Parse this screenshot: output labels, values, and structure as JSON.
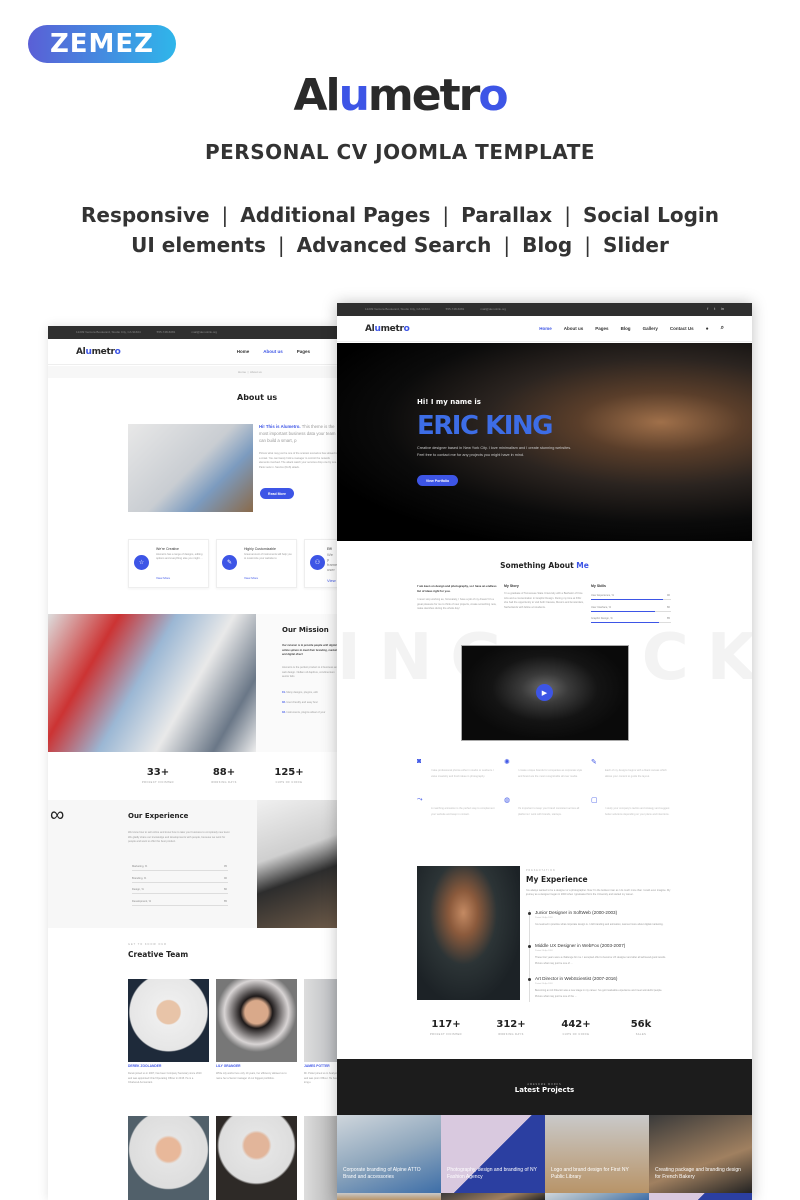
{
  "header": {
    "vendor_logo": "ZEMEZ",
    "brand_a": "Al",
    "brand_b": "u",
    "brand_c": "metr",
    "brand_d": "o",
    "subtitle": "PERSONAL CV  JOOMLA TEMPLATE",
    "features_row1": [
      "Responsive",
      "Additional Pages",
      "Parallax",
      "Social Login"
    ],
    "features_row2": [
      "UI elements",
      "Advanced Search",
      "Blog",
      "Slider"
    ],
    "separator": "|"
  },
  "colors": {
    "accent": "#3d55e6",
    "dark": "#2f2f2f"
  },
  "left_mock": {
    "topbar": [
      "12209 Ventura Boulevard, Studio City, CA 91604",
      "555-748-6081",
      "mail@demolink.org"
    ],
    "logo": "Alumetro",
    "nav": [
      "Home",
      "About us",
      "Pages"
    ],
    "active_nav": "About us",
    "breadcrumb": [
      "Home",
      "About us"
    ],
    "about_title": "About us",
    "intro_highlight": "Hi! This is Alumetro.",
    "intro_rest": "This theme is the most important business data your team can build a smart, p",
    "intro_body": "Picture what may just be one of the scariest scenarios has slowed to a crawl. You can barely hold a manager to control the network elements involved. The attack watch your services drop one by one. Panic sets in. Service (DoS) attack.",
    "read_more": "Read More",
    "cards": [
      {
        "title": "We're Creative",
        "text": "Alumetro has a range of designs, editing options and everything else you might ...",
        "link": "View More",
        "icon": "star-icon"
      },
      {
        "title": "Highly Customizable",
        "text": "Great amount of instruments will help you to customize your website to",
        "link": "View More",
        "icon": "brush-icon"
      },
      {
        "title": "Effi",
        "text": "We p frame user",
        "link": "View",
        "icon": "users-icon"
      }
    ],
    "mission_title": "Our Mission",
    "mission_lead": "Our mission is to provide people with digital and online sphere to meet their branding, marketing and digital direct",
    "mission_body": "Alumetro is the perfect product to d business and web design. Nullam ull dapibus, condimentum auctor felis",
    "mission_list": [
      {
        "num": "01.",
        "text": "Many designs, plugins, edit"
      },
      {
        "num": "02.",
        "text": "User-friendly and easy func"
      },
      {
        "num": "03.",
        "text": "Instruments, plugins allowi of your"
      }
    ],
    "stats": [
      {
        "value": "33+",
        "label": "PROJECT FINISHED"
      },
      {
        "value": "88+",
        "label": "WORKING DAYS"
      },
      {
        "value": "125+",
        "label": "CUPS OF COFFE"
      }
    ],
    "experience_title": "Our Experience",
    "experience_body": "We know how to sell online and know how to take your business to completely new level. We gladly share our knowledge and developments with people, because we work for people and want to offer the best product.",
    "skills": [
      {
        "label": "Marketing, %",
        "value": 95
      },
      {
        "label": "Branding, %",
        "value": 90
      },
      {
        "label": "Design, %",
        "value": 80
      },
      {
        "label": "Development, %",
        "value": 85
      }
    ],
    "team_kicker": "GET TO KNOW OUR",
    "team_title": "Creative Team",
    "team": [
      {
        "name": "DEREK ZOOLANDER",
        "bio": "Derek joined us in 2007, has been Company Secretary since 2010 and was appointed Chief Operating Officer in 2015. He is a Chartered Accountant."
      },
      {
        "name": "LILY GRANGER",
        "bio": "While Lily works here only 10 years, her efficiency allowed us to name her a Senior manager of our biggest portfolios."
      },
      {
        "name": "JAMES POTTER",
        "bio": "Mr. Potter joined us in Analyst and was prom Officer. He has long e"
      }
    ]
  },
  "right_mock": {
    "topbar": [
      "12209 Ventura Boulevard, Studio City, CA 91604",
      "555-748-6081",
      "mail@demolink.org"
    ],
    "social": [
      "f",
      "t",
      "in"
    ],
    "logo": "Alumetro",
    "nav": [
      "Home",
      "About us",
      "Pages",
      "Blog",
      "Gallery",
      "Contact Us"
    ],
    "active_nav": "Home",
    "hero_greeting": "Hi! I my name is",
    "hero_name": "ERIC KING",
    "hero_desc": "Creative designer based in New York City. I love minimalism and I create stunning websites. Feel free to contact me for any projects you might have in mind.",
    "hero_button": "View Portfolio",
    "about_title_a": "Something About ",
    "about_title_b": "Me",
    "col1_lead": "I' am keen on design and photography, so I have an endless list of ideas right for you.",
    "col1_body": "I never stop working as, fortunately, I have a job of my dream! It's a great pleasure for me to think of new projects, create something new, make sketches during the whole day!",
    "story_title": "My Story",
    "story_body": "I'm a graduate of Tennessee State University with a Bachelor of Fine Arts and a concentration in Graphic Design. During my time at KSU she had the opportunity to visit both Oaxaca, Mexico and Amsterdam, Netherlands with fellow art students.",
    "skills_title": "My Skills",
    "skills": [
      {
        "label": "User Experience, %",
        "value": 90
      },
      {
        "label": "User Interface, %",
        "value": 80
      },
      {
        "label": "Graphic Design, %",
        "value": 85
      }
    ],
    "watermark": "ING   CK",
    "services": [
      {
        "icon": "camera-icon",
        "text": "I take professional photos either in studio or outdoors. I value creativity and fresh ideas in photography."
      },
      {
        "icon": "bulb-icon",
        "text": "I create unique brands for companies as corporate style and brand are the most recognizable all over media."
      },
      {
        "icon": "pencil-icon",
        "text": "Each of my designs begins with a blank canvas which allows your content to guide the layout."
      },
      {
        "icon": "animation-icon",
        "text": "A matching animation is the perfect way to complement your website and keep in contact."
      },
      {
        "icon": "globe-icon",
        "text": "It's important to keep your brand consistent across all platforms I work with brands, startups."
      },
      {
        "icon": "clipboard-icon",
        "text": "I study your company's tactics and strategy and suggest better solutions depending on your plans and intentions."
      }
    ],
    "exp_kicker": "PRESENTATION",
    "exp_title": "My Experience",
    "exp_intro": "I've always wanted to be a designer or a photographer. Now I'm the luckiest man as I do much more than I could even imagine. My journey as a designer began in 2000 when I graduated from the University and started my career.",
    "jobs": [
      {
        "title": "Junior Designer in SoftWeb (2000-2003)",
        "date": "Posted 16 Apr 2018",
        "text": "I've learned in practice what corporate design is. I did branding and animation, learned more about digital marketing."
      },
      {
        "title": "Middle UX Designer in WebFox (2003-2007)",
        "date": "Posted 16 Apr 2018",
        "text": "These four years were a challenge for me. I accepted offer to become UX designer and after all achieved good results. Picture what may just be one of ..."
      },
      {
        "title": "Art Director in WebScientist (2007-2016)",
        "date": "Posted 16 Apr 2018",
        "text": "Becoming an Art Director was a new stage in my career. I've got invaluable experience and meet wonderful people. Picture what may just be one of the ..."
      }
    ],
    "stats": [
      {
        "value": "117+",
        "label": "PROJECT FINISHED"
      },
      {
        "value": "312+",
        "label": "WORKING DAYS"
      },
      {
        "value": "442+",
        "label": "CUPS OF COFFE"
      },
      {
        "value": "56k",
        "label": "SALES"
      }
    ],
    "projects_kicker": "AWESOME WORKS",
    "projects_title": "Latest Projects",
    "projects": [
      "Corporate branding of Alpine ATTO Brand and accessories",
      "Photography, design and branding of NY Fashion Agency",
      "Logo and brand design for First NY Public Library",
      "Creating package and branding design for French Bakery"
    ]
  }
}
